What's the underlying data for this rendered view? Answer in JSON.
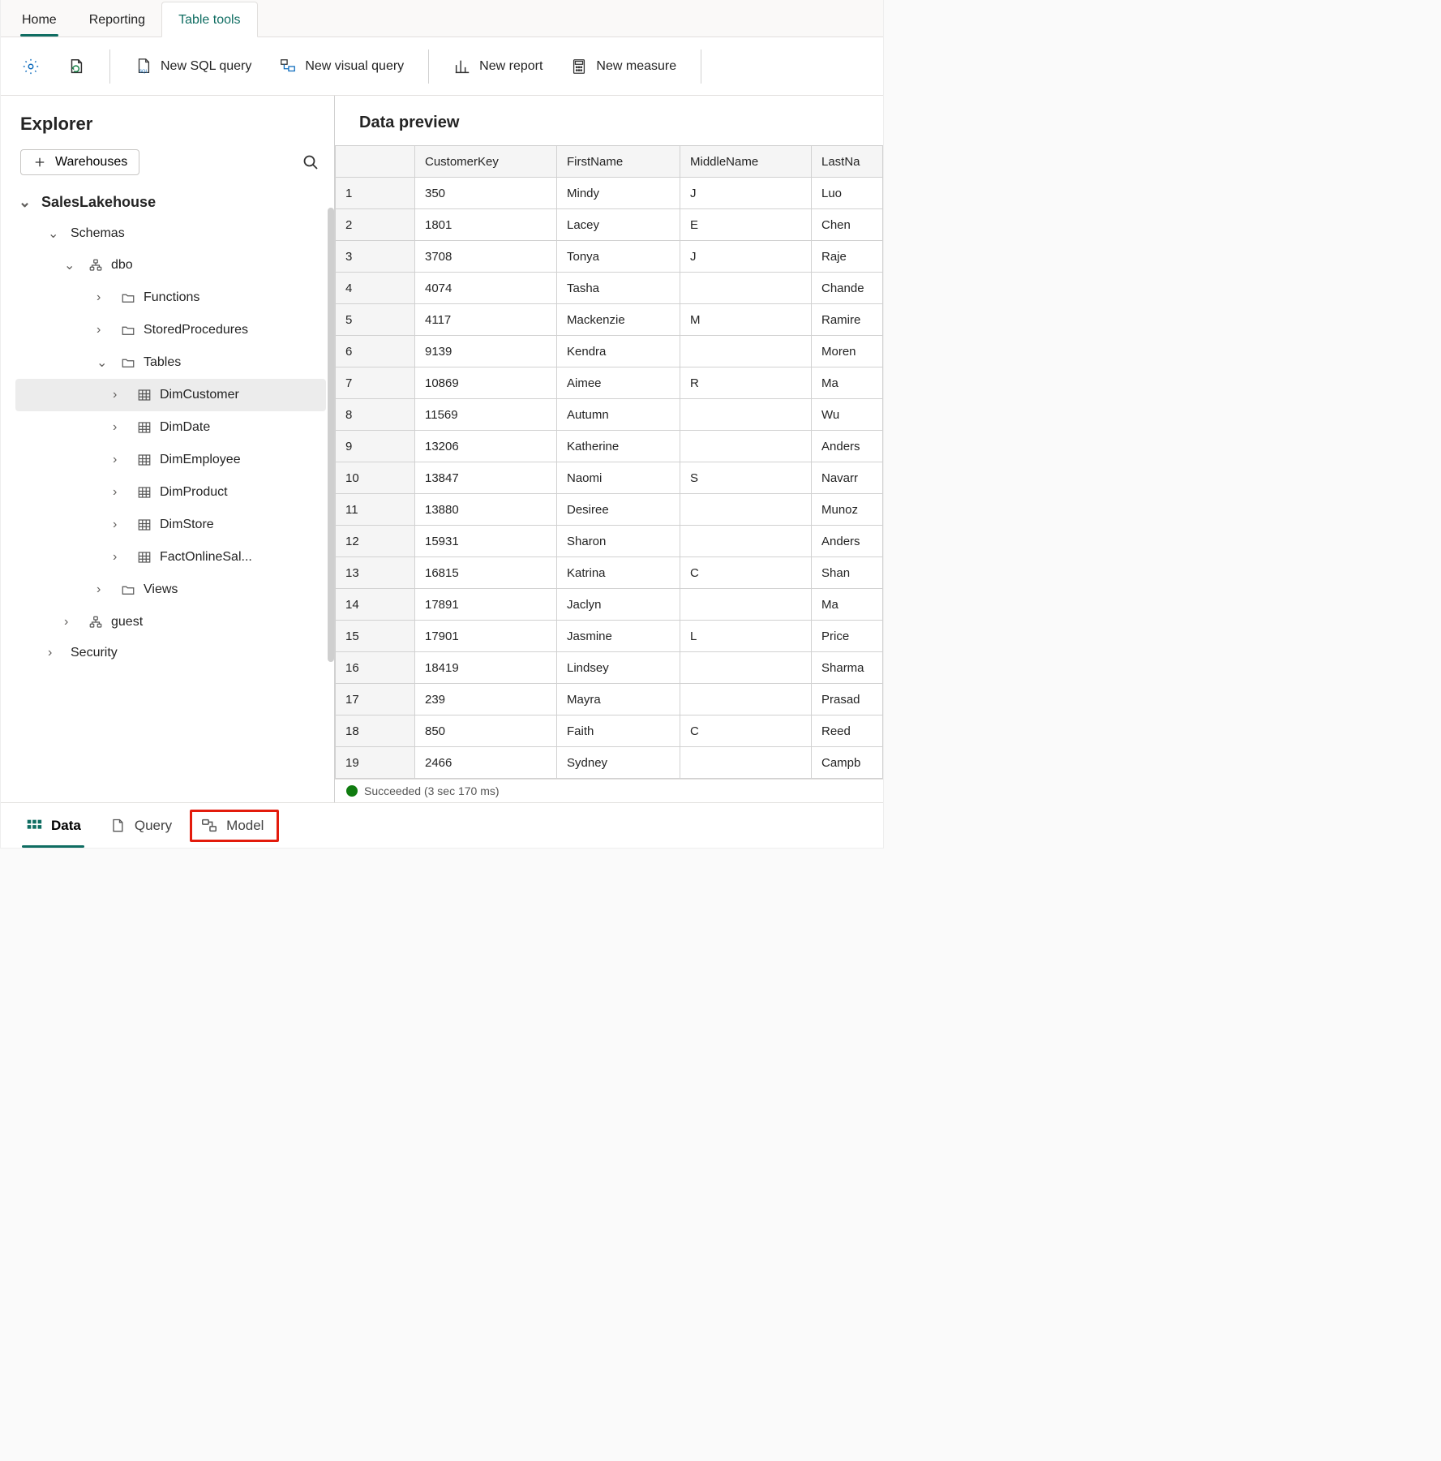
{
  "tabs": {
    "home": "Home",
    "reporting": "Reporting",
    "tableTools": "Table tools"
  },
  "ribbon": {
    "newSql": "New SQL query",
    "newVisual": "New visual query",
    "newReport": "New report",
    "newMeasure": "New measure"
  },
  "explorer": {
    "title": "Explorer",
    "warehousesBtn": "Warehouses",
    "tree": {
      "db": "SalesLakehouse",
      "schemas": "Schemas",
      "dbo": "dbo",
      "functions": "Functions",
      "sp": "StoredProcedures",
      "tables": "Tables",
      "tableList": [
        "DimCustomer",
        "DimDate",
        "DimEmployee",
        "DimProduct",
        "DimStore",
        "FactOnlineSal..."
      ],
      "views": "Views",
      "guest": "guest",
      "security": "Security"
    }
  },
  "preview": {
    "title": "Data preview",
    "columns": [
      "",
      "CustomerKey",
      "FirstName",
      "MiddleName",
      "LastNa"
    ],
    "rows": [
      {
        "n": "1",
        "ck": "350",
        "fn": "Mindy",
        "mn": "J",
        "ln": "Luo"
      },
      {
        "n": "2",
        "ck": "1801",
        "fn": "Lacey",
        "mn": "E",
        "ln": "Chen"
      },
      {
        "n": "3",
        "ck": "3708",
        "fn": "Tonya",
        "mn": "J",
        "ln": "Raje"
      },
      {
        "n": "4",
        "ck": "4074",
        "fn": "Tasha",
        "mn": "",
        "ln": "Chande"
      },
      {
        "n": "5",
        "ck": "4117",
        "fn": "Mackenzie",
        "mn": "M",
        "ln": "Ramire"
      },
      {
        "n": "6",
        "ck": "9139",
        "fn": "Kendra",
        "mn": "",
        "ln": "Moren"
      },
      {
        "n": "7",
        "ck": "10869",
        "fn": "Aimee",
        "mn": "R",
        "ln": "Ma"
      },
      {
        "n": "8",
        "ck": "11569",
        "fn": "Autumn",
        "mn": "",
        "ln": "Wu"
      },
      {
        "n": "9",
        "ck": "13206",
        "fn": "Katherine",
        "mn": "",
        "ln": "Anders"
      },
      {
        "n": "10",
        "ck": "13847",
        "fn": "Naomi",
        "mn": "S",
        "ln": "Navarr"
      },
      {
        "n": "11",
        "ck": "13880",
        "fn": "Desiree",
        "mn": "",
        "ln": "Munoz"
      },
      {
        "n": "12",
        "ck": "15931",
        "fn": "Sharon",
        "mn": "",
        "ln": "Anders"
      },
      {
        "n": "13",
        "ck": "16815",
        "fn": "Katrina",
        "mn": "C",
        "ln": "Shan"
      },
      {
        "n": "14",
        "ck": "17891",
        "fn": "Jaclyn",
        "mn": "",
        "ln": "Ma"
      },
      {
        "n": "15",
        "ck": "17901",
        "fn": "Jasmine",
        "mn": "L",
        "ln": "Price"
      },
      {
        "n": "16",
        "ck": "18419",
        "fn": "Lindsey",
        "mn": "",
        "ln": "Sharma"
      },
      {
        "n": "17",
        "ck": "239",
        "fn": "Mayra",
        "mn": "",
        "ln": "Prasad"
      },
      {
        "n": "18",
        "ck": "850",
        "fn": "Faith",
        "mn": "C",
        "ln": "Reed"
      },
      {
        "n": "19",
        "ck": "2466",
        "fn": "Sydney",
        "mn": "",
        "ln": "Campb"
      }
    ],
    "status": "Succeeded (3 sec 170 ms)"
  },
  "bottomTabs": {
    "data": "Data",
    "query": "Query",
    "model": "Model"
  }
}
